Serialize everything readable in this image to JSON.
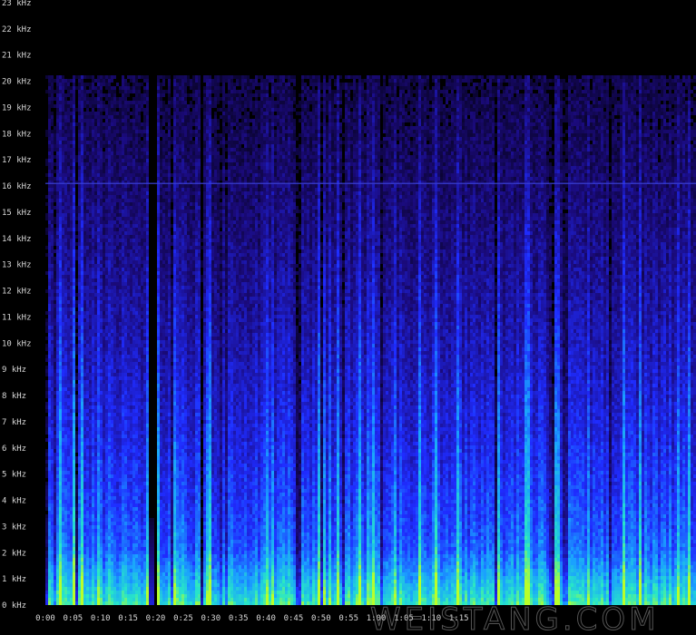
{
  "chart_data": {
    "type": "heatmap",
    "title": "",
    "xlabel": "",
    "ylabel": "",
    "x_unit": "time (m:ss)",
    "y_unit": "kHz",
    "xlim": [
      0,
      118
    ],
    "ylim": [
      0,
      23
    ],
    "x_ticks": [
      {
        "value": 0,
        "label": "0:00"
      },
      {
        "value": 5,
        "label": "0:05"
      },
      {
        "value": 10,
        "label": "0:10"
      },
      {
        "value": 15,
        "label": "0:15"
      },
      {
        "value": 20,
        "label": "0:20"
      },
      {
        "value": 25,
        "label": "0:25"
      },
      {
        "value": 30,
        "label": "0:30"
      },
      {
        "value": 35,
        "label": "0:35"
      },
      {
        "value": 40,
        "label": "0:40"
      },
      {
        "value": 45,
        "label": "0:45"
      },
      {
        "value": 50,
        "label": "0:50"
      },
      {
        "value": 55,
        "label": "0:55"
      },
      {
        "value": 60,
        "label": "1:00"
      },
      {
        "value": 65,
        "label": "1:05"
      },
      {
        "value": 70,
        "label": "1:10"
      },
      {
        "value": 75,
        "label": "1:15"
      }
    ],
    "y_ticks": [
      {
        "value": 0,
        "label": "0 kHz"
      },
      {
        "value": 1,
        "label": "1 kHz"
      },
      {
        "value": 2,
        "label": "2 kHz"
      },
      {
        "value": 3,
        "label": "3 kHz"
      },
      {
        "value": 4,
        "label": "4 kHz"
      },
      {
        "value": 5,
        "label": "5 kHz"
      },
      {
        "value": 6,
        "label": "6 kHz"
      },
      {
        "value": 7,
        "label": "7 kHz"
      },
      {
        "value": 8,
        "label": "8 kHz"
      },
      {
        "value": 9,
        "label": "9 kHz"
      },
      {
        "value": 10,
        "label": "10 kHz"
      },
      {
        "value": 11,
        "label": "11 kHz"
      },
      {
        "value": 12,
        "label": "12 kHz"
      },
      {
        "value": 13,
        "label": "13 kHz"
      },
      {
        "value": 14,
        "label": "14 kHz"
      },
      {
        "value": 15,
        "label": "15 kHz"
      },
      {
        "value": 16,
        "label": "16 kHz"
      },
      {
        "value": 17,
        "label": "17 kHz"
      },
      {
        "value": 18,
        "label": "18 kHz"
      },
      {
        "value": 19,
        "label": "19 kHz"
      },
      {
        "value": 20,
        "label": "20 kHz"
      },
      {
        "value": 21,
        "label": "21 kHz"
      },
      {
        "value": 22,
        "label": "22 kHz"
      },
      {
        "value": 23,
        "label": "23 kHz"
      }
    ],
    "frequency_cutoff_khz": 20.3,
    "tone_line_khz": 16.1,
    "silent_gap_seconds": [
      18.3,
      20.2
    ],
    "colormap": [
      "#000000",
      "#1a0a7a",
      "#1f2cff",
      "#1aa0ff",
      "#27e6c8",
      "#b8ff2a"
    ],
    "grid": false,
    "legend": "none",
    "watermark": "WEISTANG.COM"
  }
}
